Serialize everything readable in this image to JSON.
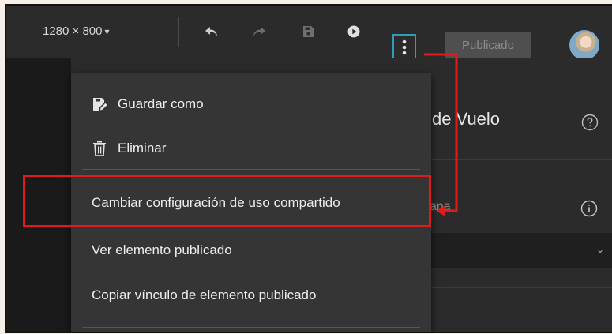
{
  "toolbar": {
    "resolution": "1280 × 800",
    "resolution_caret": "▾",
    "publish_label": "Publicado",
    "icons": [
      "undo-icon",
      "redo-icon",
      "save-icon",
      "play-icon",
      "more-vertical-icon"
    ]
  },
  "menu": {
    "items": [
      {
        "label": "Guardar como",
        "icon": "save-as-icon"
      },
      {
        "label": "Eliminar",
        "icon": "trash-icon"
      },
      {
        "label": "Cambiar configuración de uso compartido"
      },
      {
        "label": "Ver elemento publicado"
      },
      {
        "label": "Copiar vínculo de elemento publicado"
      }
    ]
  },
  "panel": {
    "title_fragment": "de Vuelo",
    "field_label_fragment": "ana"
  },
  "colors": {
    "highlight": "#e01b1b",
    "more_button_border": "#2e9db5",
    "background": "#2b2b2b",
    "menu_background": "#353535"
  }
}
